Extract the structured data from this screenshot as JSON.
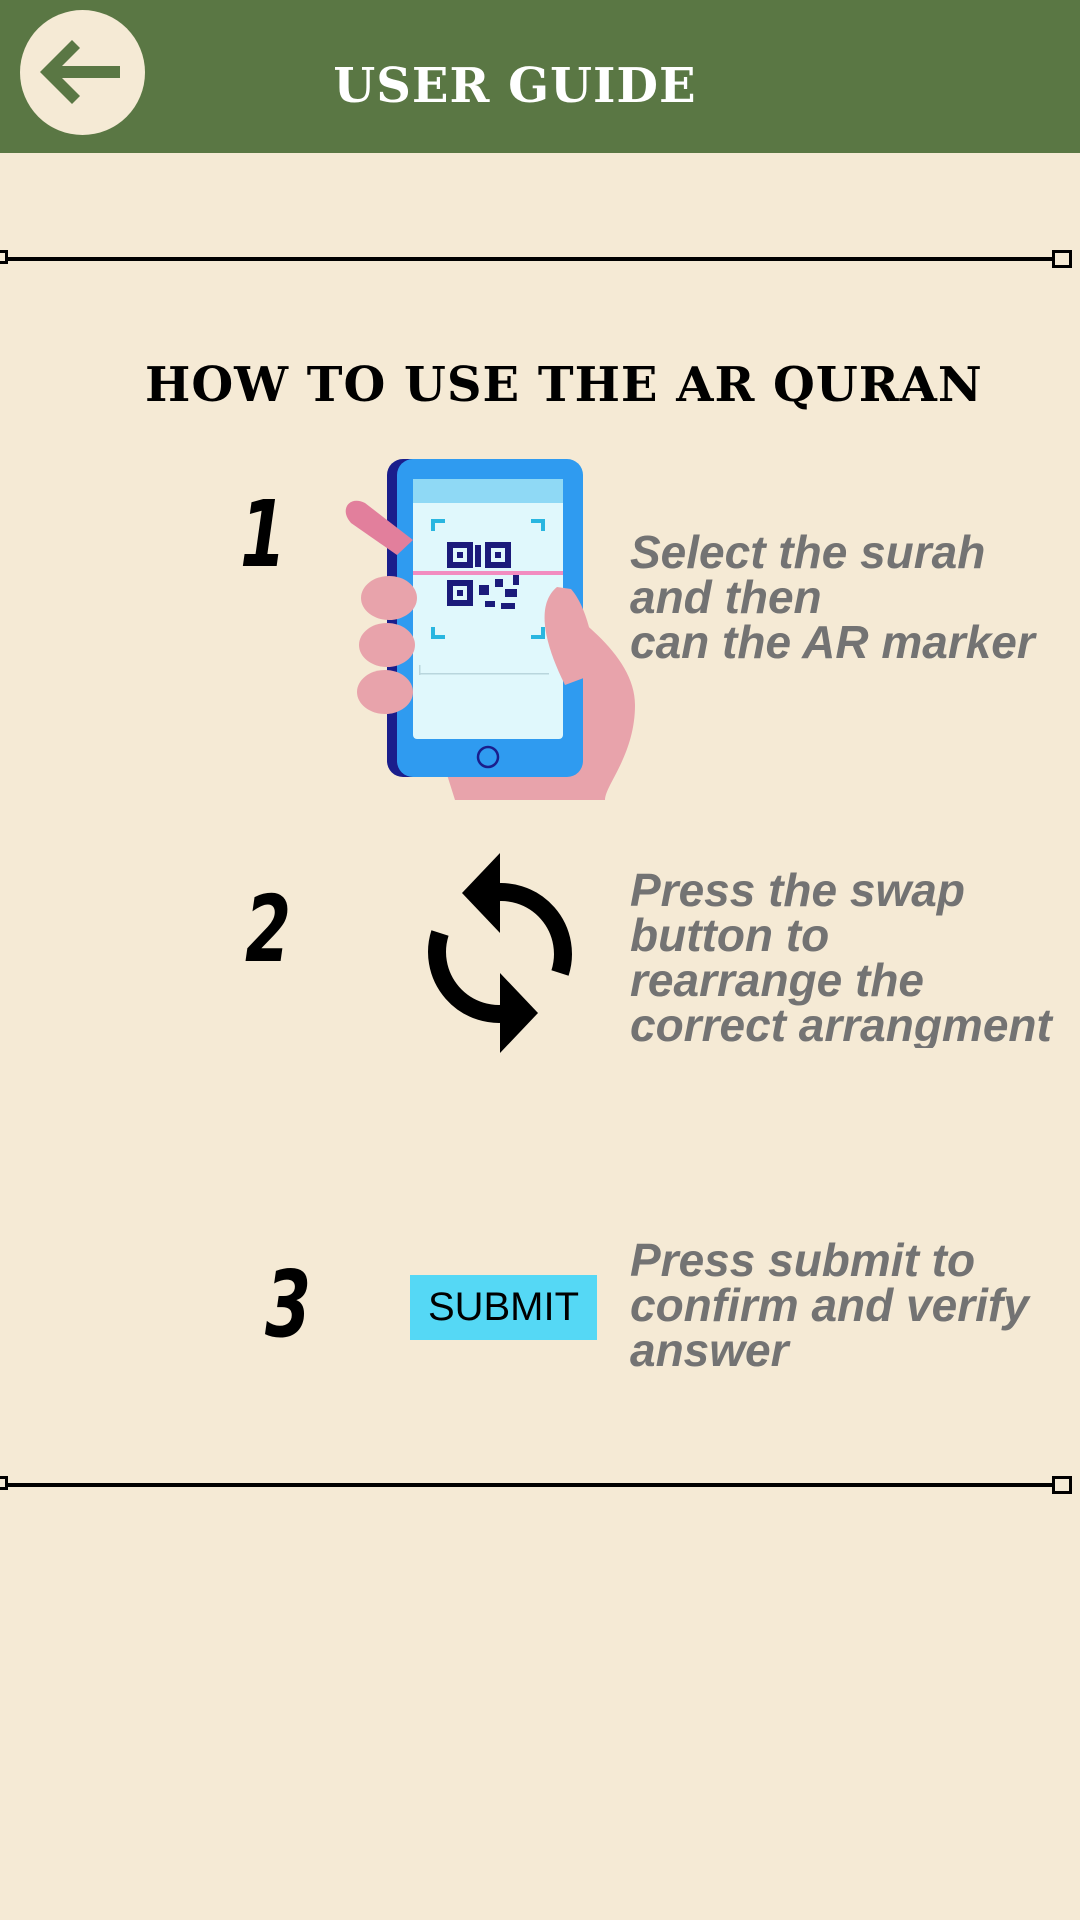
{
  "header": {
    "title": "USER GUIDE",
    "back_icon": "arrow-left-icon"
  },
  "guide": {
    "title": "HOW TO USE THE AR QURAN",
    "steps": [
      {
        "number": "1",
        "text": "Select the surah\nand then\ncan the AR marker",
        "icon": "phone-qr-scan-icon"
      },
      {
        "number": "2",
        "text": "Press the swap\nbutton to\nrearrange the\ncorrect arrangment",
        "icon": "swap-icon"
      },
      {
        "number": "3",
        "text": "Press submit to\nconfirm and verify\nanswer",
        "button_label": "SUBMIT"
      }
    ]
  },
  "colors": {
    "header_bg": "#5a7744",
    "page_bg": "#f5ead5",
    "submit_bg": "#55d8f5",
    "step_text": "#737373"
  }
}
